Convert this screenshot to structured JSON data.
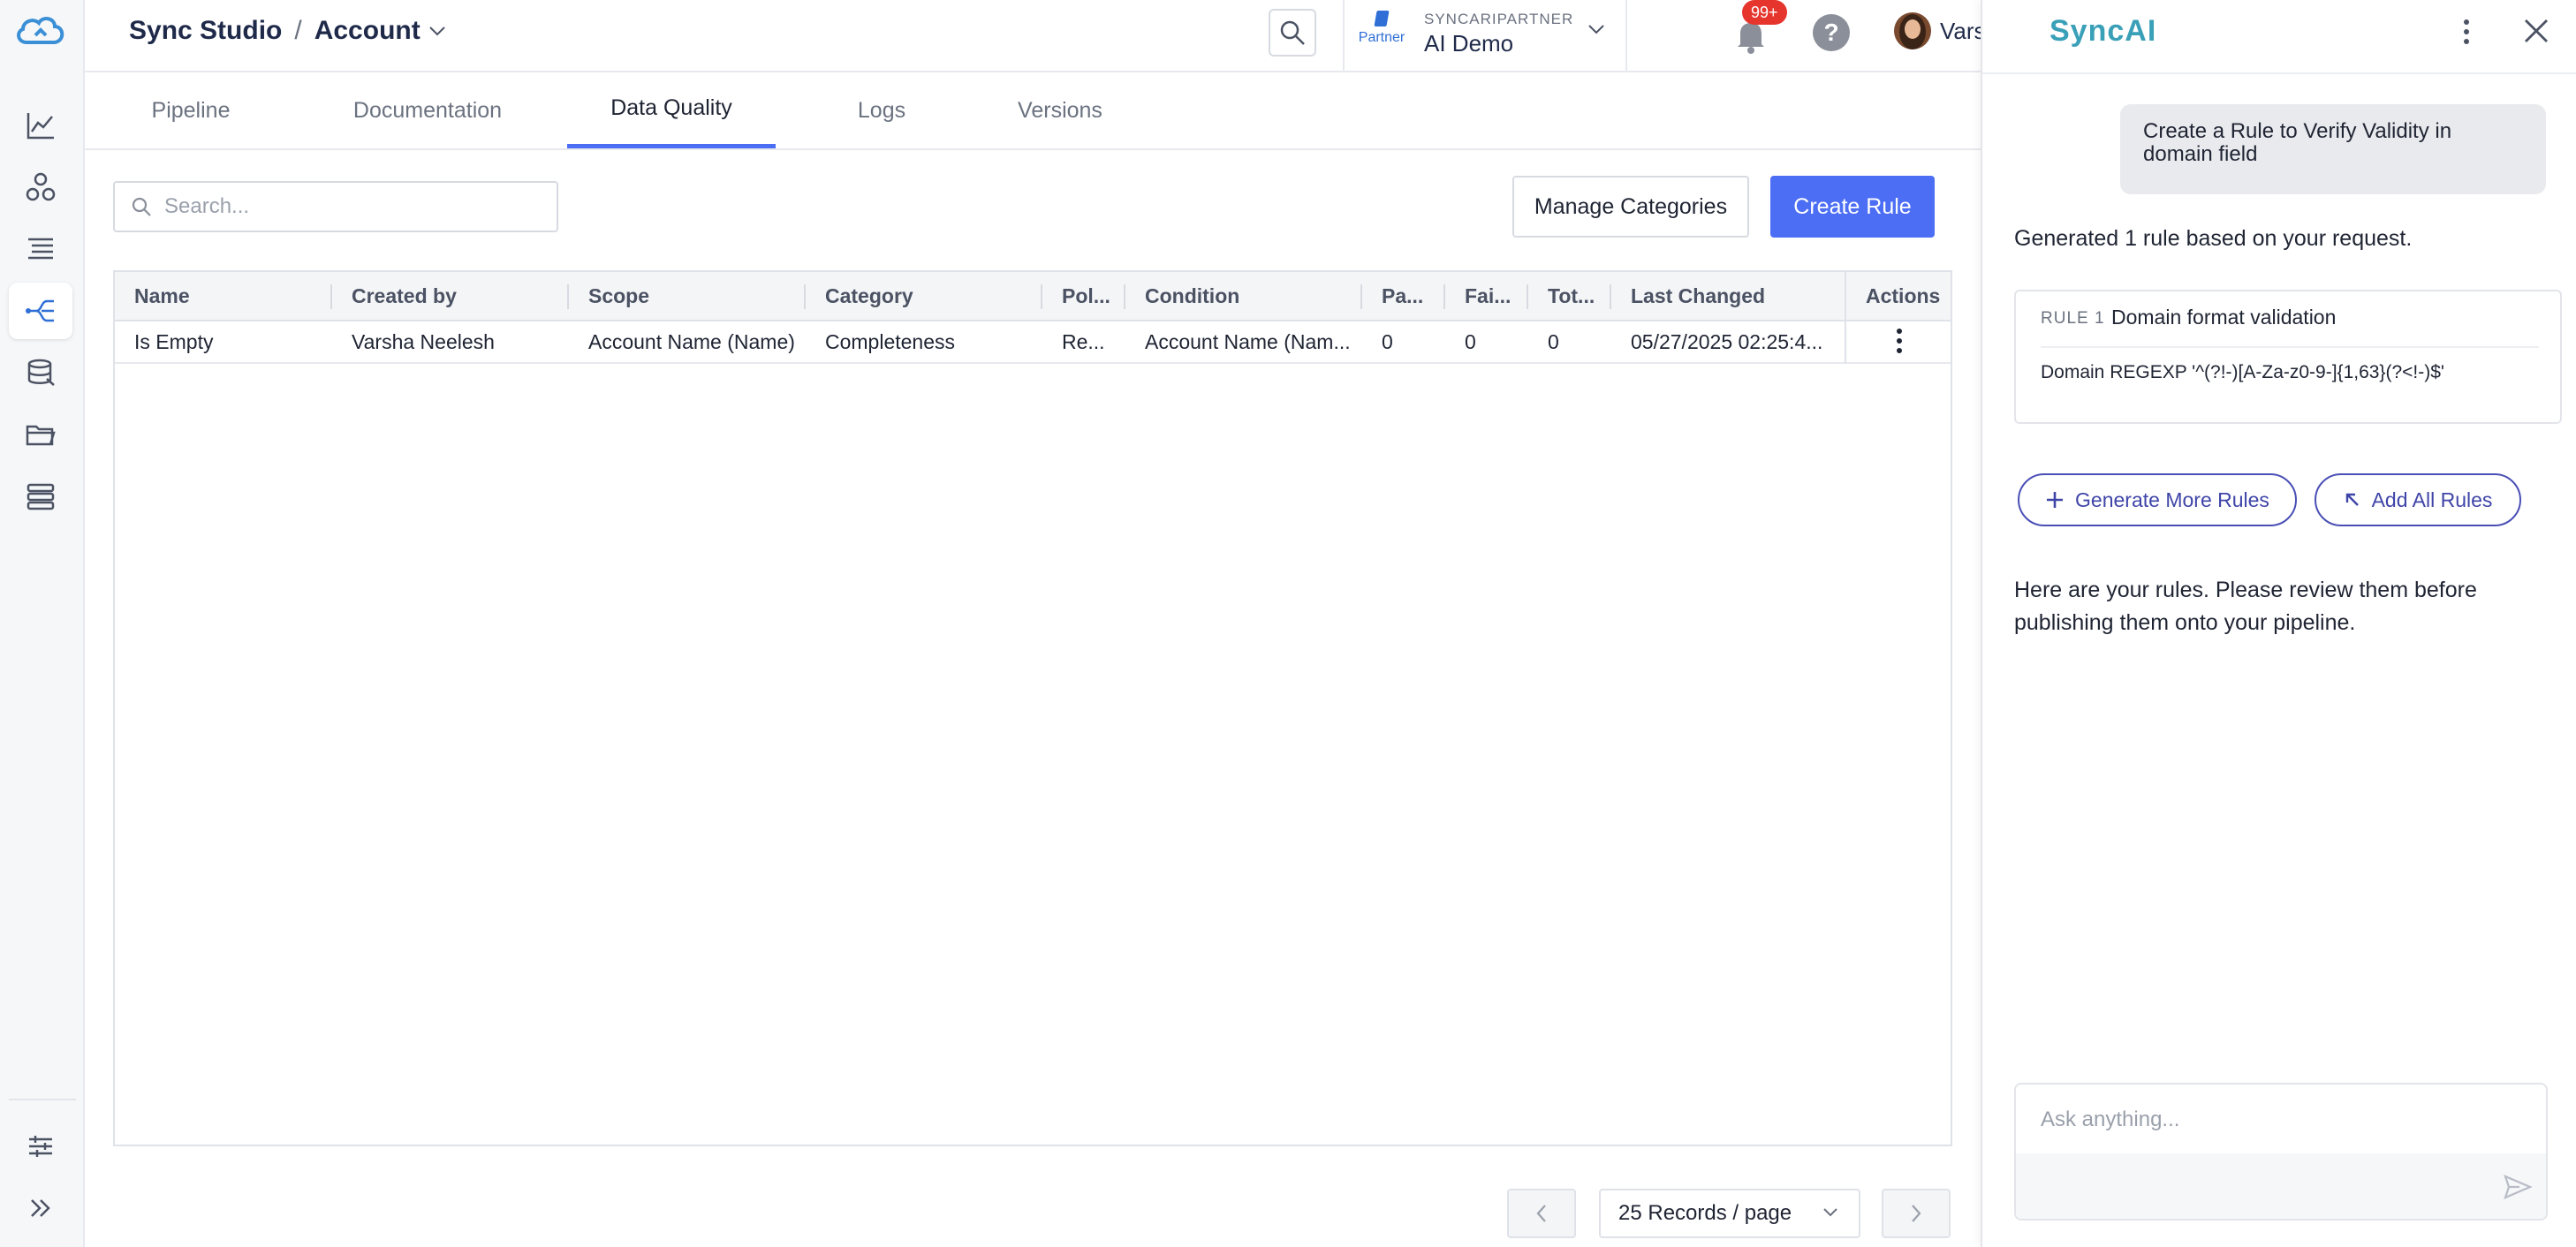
{
  "header": {
    "breadcrumb_root": "Sync Studio",
    "breadcrumb_sep": "/",
    "breadcrumb_current": "Account",
    "partner_org": "SYNCARIPARTNER",
    "partner_name": "AI Demo",
    "partner_logo_text": "Partner",
    "notifications_badge": "99+",
    "help_label": "?",
    "user_name": "Varsha"
  },
  "nav": {
    "items": [
      "dashboard-icon",
      "entities-icon",
      "list-icon",
      "pipeline-icon",
      "data-icon",
      "folder-icon",
      "storage-icon"
    ],
    "active": "pipeline-icon",
    "bottom": [
      "settings-sliders-icon",
      "expand-icon"
    ]
  },
  "tabs": [
    {
      "label": "Pipeline"
    },
    {
      "label": "Documentation"
    },
    {
      "label": "Data Quality",
      "active": true
    },
    {
      "label": "Logs"
    },
    {
      "label": "Versions"
    }
  ],
  "toolbar": {
    "search_placeholder": "Search...",
    "manage_label": "Manage Categories",
    "create_label": "Create Rule"
  },
  "table": {
    "columns": [
      "Name",
      "Created by",
      "Scope",
      "Category",
      "Pol...",
      "Condition",
      "Pa...",
      "Fai...",
      "Tot...",
      "Last Changed",
      "Actions"
    ],
    "rows": [
      [
        "Is Empty",
        "Varsha Neelesh",
        "Account Name (Name)",
        "Completeness",
        "Re...",
        "Account Name (Nam...",
        "0",
        "0",
        "0",
        "05/27/2025 02:25:4..."
      ]
    ]
  },
  "pagination": {
    "page_size_label": "25 Records / page"
  },
  "panel": {
    "title": "SyncAI",
    "user_message": "Create a Rule to Verify Validity in domain field",
    "ai_summary": "Generated 1 rule based on your request.",
    "rule_label": "RULE 1",
    "rule_name": "Domain format validation",
    "rule_expression": "Domain REGEXP '^(?!-)[A-Za-z0-9-]{1,63}(?<!-)$'",
    "generate_label": "Generate More Rules",
    "add_all_label": "Add All Rules",
    "ai_followup": "Here are your rules. Please review them before publishing them onto your pipeline.",
    "chat_placeholder": "Ask anything..."
  },
  "colors": {
    "accent": "#4c6ef5",
    "syncai": "#3aa0b8",
    "badge": "#e5352d"
  }
}
